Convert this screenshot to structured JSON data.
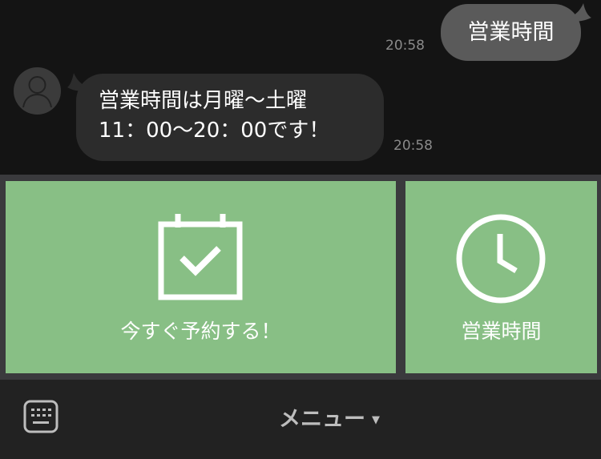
{
  "chat": {
    "outgoing": {
      "text": "営業時間",
      "time": "20:58"
    },
    "incoming": {
      "text": "営業時間は月曜〜土曜\n11：00〜20：00です！",
      "time": "20:58"
    }
  },
  "richmenu": {
    "tiles": [
      {
        "label": "今すぐ予約する！",
        "icon": "calendar-check-icon"
      },
      {
        "label": "営業時間",
        "icon": "clock-icon"
      }
    ],
    "tile_color": "#88bf85"
  },
  "bottombar": {
    "menu_label": "メニュー",
    "arrow": "▼",
    "keyboard_icon": "keyboard-icon"
  }
}
